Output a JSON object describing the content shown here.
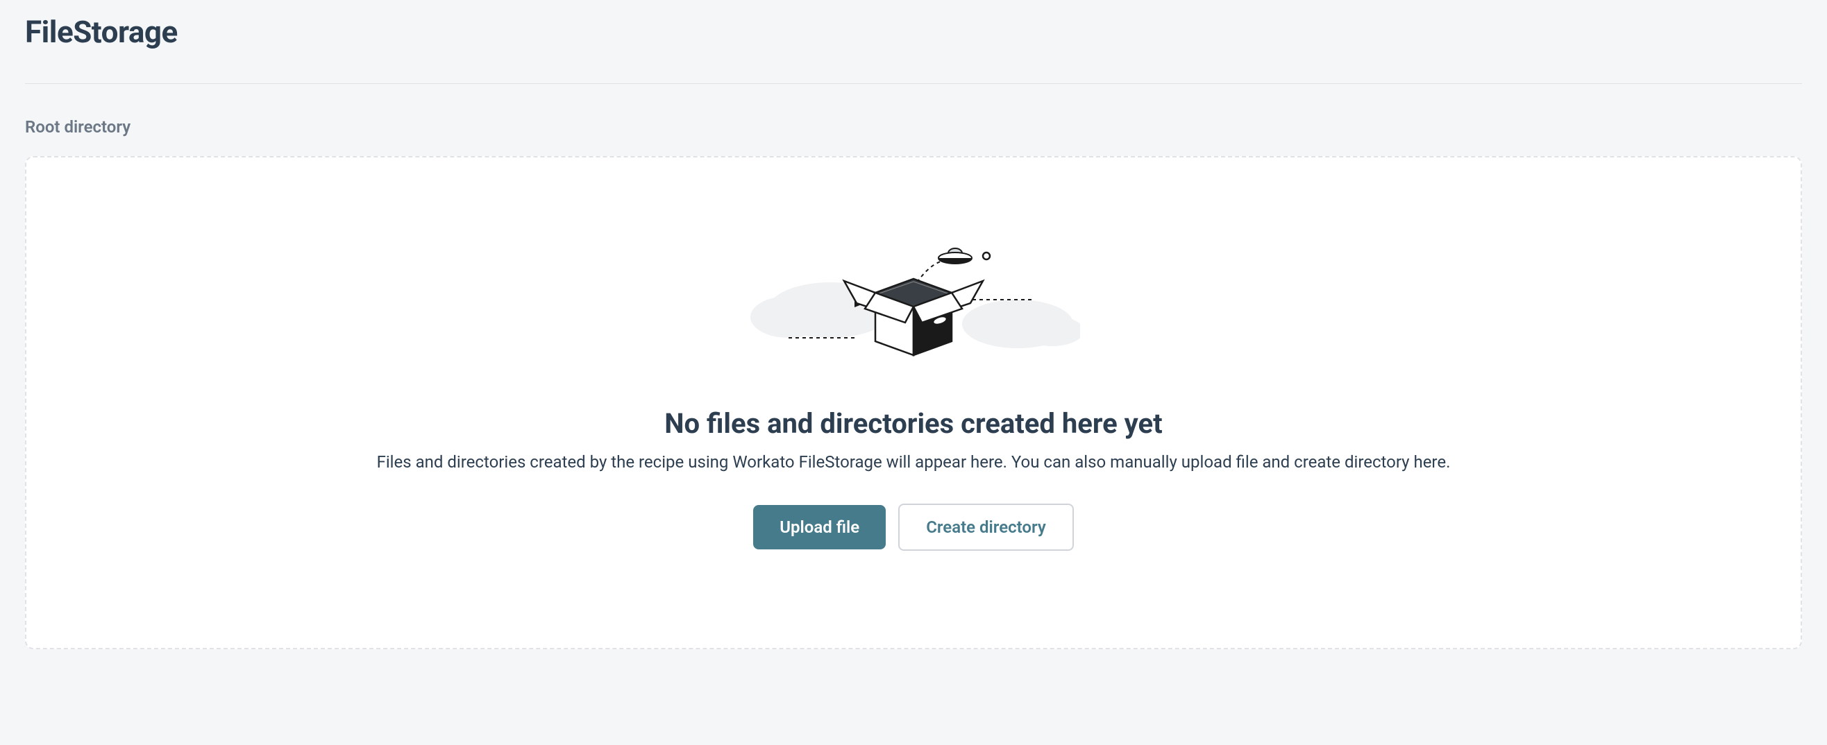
{
  "header": {
    "title": "FileStorage"
  },
  "breadcrumb": {
    "current": "Root directory"
  },
  "emptyState": {
    "heading": "No files and directories created here yet",
    "description": "Files and directories created by the recipe using Workato FileStorage will appear here. You can also manually upload file and create directory here.",
    "uploadLabel": "Upload file",
    "createLabel": "Create directory"
  },
  "illustration": {
    "name": "empty-box-ufo-icon"
  }
}
